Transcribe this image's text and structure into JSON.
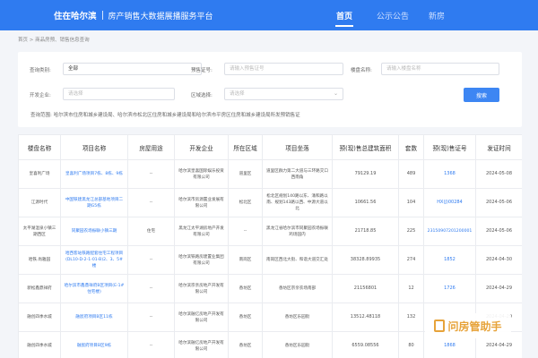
{
  "header": {
    "brand_main": "住在哈尔滨",
    "brand_sub": "房产销售大数据展播服务平台",
    "nav": [
      {
        "label": "首页",
        "active": true
      },
      {
        "label": "公示公告",
        "active": false
      },
      {
        "label": "新房",
        "active": false
      }
    ]
  },
  "breadcrumb": "首页 > 商品房预、销售信息查询",
  "filter": {
    "category_label": "查询类别:",
    "category_value": "全部",
    "permit_label": "预售证号:",
    "permit_placeholder": "请输入预售证号",
    "building_label": "楼盘名称:",
    "building_placeholder": "请输入楼盘名称",
    "developer_label": "开发企业:",
    "developer_placeholder": "请选择",
    "district_label": "区域选择:",
    "district_placeholder": "请选择",
    "search_label": "搜索",
    "scope_text": "查询范围: 哈尔滨市住房和城乡建设局、哈尔滨市松北区住房和城乡建设局和哈尔滨市平房区住房和城乡建设局所发预销售证"
  },
  "table": {
    "headers": [
      "楼盘名称",
      "项目名称",
      "房屋用途",
      "开发企业",
      "所在区域",
      "项目坐落",
      "预(现)售总建筑面积",
      "套数",
      "预(现)售证号",
      "发证时间"
    ],
    "rows": [
      [
        "皇喜利广场",
        "皇喜利广场项目7栋、8栋、9栋",
        "--",
        "哈尔滨皇喜国际娱乐投资有限公司",
        "道里区",
        "道里区群力第二大道与三环路交口西南角",
        "79129.19",
        "489",
        "1368",
        "2024-05-08"
      ],
      [
        "江源时代",
        "中国铁建黑龙江总部基地项目二期G5栋",
        "--",
        "哈尔滨市房源置业发展有限公司",
        "松北区",
        "松北区规划140路以东、涌和路以南、规划143路以西、中源大道以北",
        "10661.56",
        "104",
        "HX(J)00284",
        "2024-05-06"
      ],
      [
        "太平湖温泉小镇三期西区",
        "同聚园农场振联小镇三期",
        "住宅",
        "黑龙江太平湖房地产开发有限公司",
        "--",
        "黑龙江省哈尔滨市同聚园农场振联鸡场园内",
        "21718.85",
        "225",
        "23150907201200001",
        "2024-05-06"
      ],
      [
        "哈铁.尚雅园",
        "哈西客站铁路配套住宅工程项目(DL10-D-2-1-01-B)2、3、5#楼",
        "--",
        "哈尔滨铁路房建置业集团有限公司",
        "南岗区",
        "南岗区西北大街、和谐大道交汇处",
        "38328.89935",
        "274",
        "1852",
        "2024-04-30"
      ],
      [
        "新松鑫鼎祥府",
        "哈尔滨市鑫鼎祥府B区项目(E-1#住宅楼)",
        "--",
        "哈尔滨宗亲房地产开发有限公司",
        "香坊区",
        "香坊区宗亲农场南部",
        "21156801",
        "12",
        "1726",
        "2024-04-29"
      ],
      [
        "融创四季水城",
        "融宸府项目B区11栋",
        "--",
        "哈尔滨融亿房地产开发有限公司",
        "香坊区",
        "香坊区乐园街",
        "13512.48118",
        "132",
        "",
        "2024-04-29"
      ],
      [
        "融创四季水城",
        "融宸府项目B区9栋",
        "--",
        "哈尔滨融亿房地产开发有限公司",
        "香坊区",
        "香坊区乐园街",
        "6559.08556",
        "80",
        "1868",
        "2024-04-29"
      ]
    ]
  },
  "watermark": {
    "text": "问房管助手"
  }
}
